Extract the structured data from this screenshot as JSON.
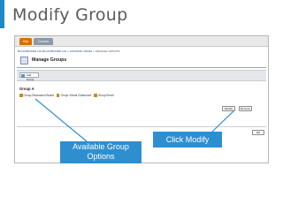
{
  "slide": {
    "title": "Modify Group"
  },
  "screenshot": {
    "tabs": [
      "Help",
      "Courses"
    ],
    "breadcrumb": {
      "course": "BLACKBOARD 101 BLACKBOARD 101",
      "sep1": " > ",
      "panel": "CONTROL PANEL",
      "sep2": " > ",
      "current": "MANAGE GROUPS"
    },
    "page_title": "Manage Groups",
    "add_group_label": "Add Group",
    "group": {
      "name": "Group A",
      "options": [
        "Group Discussion Board",
        "Group Virtual Classroom",
        "Group Email"
      ]
    },
    "buttons": {
      "modify": "Modify",
      "remove": "Remove",
      "ok": "OK"
    }
  },
  "callouts": {
    "options_line1": "Available Group",
    "options_line2": "Options",
    "modify": "Click Modify"
  },
  "colors": {
    "accent": "#1e88c8",
    "callout": "#2e8fd0",
    "tab_active": "#d96f00",
    "link": "#1a3f9a"
  }
}
